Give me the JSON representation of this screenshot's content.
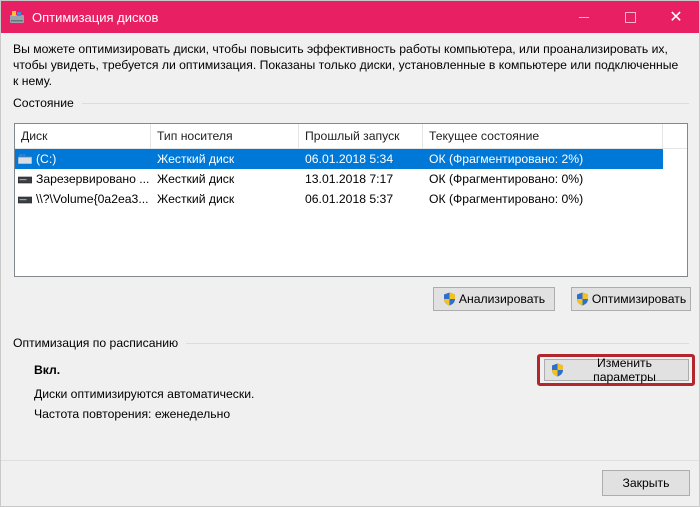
{
  "window": {
    "title": "Оптимизация дисков",
    "accent_color": "#e81f63",
    "close_glyph": "✕"
  },
  "description": "Вы можете оптимизировать диски, чтобы повысить эффективность работы  компьютера, или проанализировать их, чтобы увидеть, требуется ли оптимизация. Показаны только диски, установленные в компьютере или подключенные к нему.",
  "status_section": {
    "label": "Состояние",
    "columns": [
      "Диск",
      "Тип носителя",
      "Прошлый запуск",
      "Текущее состояние"
    ],
    "rows": [
      {
        "disk": "(C:)",
        "icon": "windows-drive-icon",
        "media": "Жесткий диск",
        "last_run": "06.01.2018 5:34",
        "status": "ОК (Фрагментировано: 2%)",
        "selected": true
      },
      {
        "disk": "Зарезервировано ...",
        "icon": "hard-drive-icon",
        "media": "Жесткий диск",
        "last_run": "13.01.2018 7:17",
        "status": "ОК (Фрагментировано: 0%)",
        "selected": false
      },
      {
        "disk": "\\\\?\\Volume{0a2ea3...",
        "icon": "hard-drive-icon",
        "media": "Жесткий диск",
        "last_run": "06.01.2018 5:37",
        "status": "ОК (Фрагментировано: 0%)",
        "selected": false
      }
    ],
    "analyze_button": "Анализировать",
    "optimize_button": "Оптимизировать"
  },
  "schedule_section": {
    "label": "Оптимизация по расписанию",
    "state": "Вкл.",
    "auto_text": "Диски оптимизируются автоматически.",
    "frequency_text": "Частота повторения: еженедельно",
    "change_button": "Изменить параметры",
    "highlight_color": "#b4262d"
  },
  "footer": {
    "close_button": "Закрыть"
  }
}
